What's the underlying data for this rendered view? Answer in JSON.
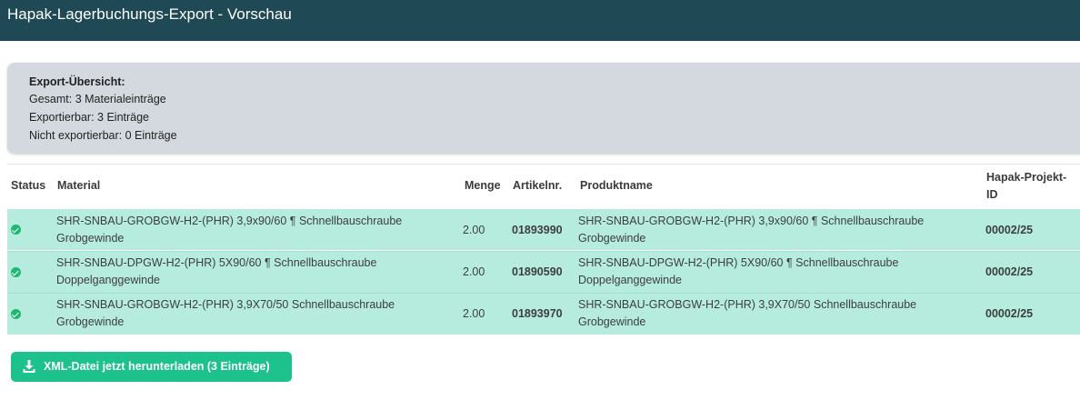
{
  "header": {
    "title": "Hapak-Lagerbuchungs-Export - Vorschau"
  },
  "summary": {
    "title": "Export-Übersicht:",
    "total": "Gesamt: 3 Materialeinträge",
    "exportable": "Exportierbar: 3 Einträge",
    "not_exportable": "Nicht exportierbar: 0 Einträge"
  },
  "table": {
    "headers": {
      "status": "Status",
      "material": "Material",
      "menge": "Menge",
      "artikelnr": "Artikelnr.",
      "produktname": "Produktname",
      "projekt_line1": "Hapak-Projekt-",
      "projekt_line2": "ID"
    },
    "rows": [
      {
        "status_icon": "check-circle-icon",
        "material_line1": "SHR-SNBAU-GROBGW-H2-(PHR) 3,9x90/60 ¶ Schnellbauschraube",
        "material_line2": "Grobgewinde",
        "menge": "2.00",
        "artikelnr": "01893990",
        "produktname_line1": "SHR-SNBAU-GROBGW-H2-(PHR) 3,9x90/60 ¶ Schnellbauschraube",
        "produktname_line2": "Grobgewinde",
        "projekt": "00002/25"
      },
      {
        "status_icon": "check-circle-icon",
        "material_line1": "SHR-SNBAU-DPGW-H2-(PHR) 5X90/60 ¶ Schnellbauschraube",
        "material_line2": "Doppelganggewinde",
        "menge": "2.00",
        "artikelnr": "01890590",
        "produktname_line1": "SHR-SNBAU-DPGW-H2-(PHR) 5X90/60 ¶ Schnellbauschraube",
        "produktname_line2": "Doppelganggewinde",
        "projekt": "00002/25"
      },
      {
        "status_icon": "check-circle-icon",
        "material_line1": "SHR-SNBAU-GROBGW-H2-(PHR) 3,9X70/50 Schnellbauschraube",
        "material_line2": "Grobgewinde",
        "menge": "2.00",
        "artikelnr": "01893970",
        "produktname_line1": "SHR-SNBAU-GROBGW-H2-(PHR) 3,9X70/50 Schnellbauschraube",
        "produktname_line2": "Grobgewinde",
        "projekt": "00002/25"
      }
    ]
  },
  "download_button": {
    "label": "XML-Datei jetzt herunterladen (3 Einträge)",
    "icon": "download-icon"
  },
  "colors": {
    "header_bg": "#1f4a55",
    "summary_bg": "#d3d9de",
    "row_bg": "#b5ecdd",
    "status_ok": "#1fb872",
    "button_bg": "#1cc18b"
  }
}
